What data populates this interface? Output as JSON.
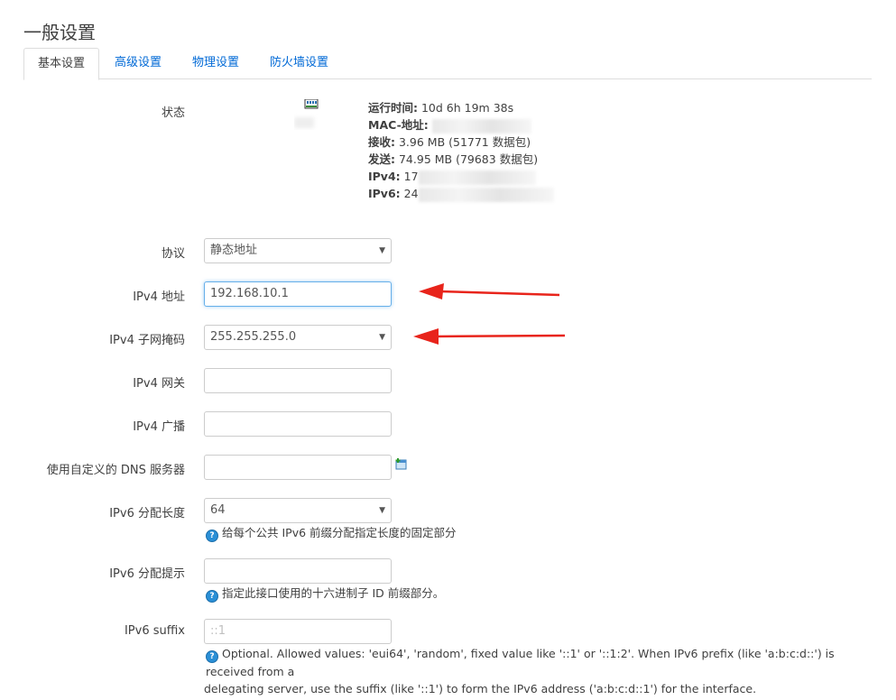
{
  "page": {
    "title": "一般设置"
  },
  "tabs": [
    {
      "label": "基本设置",
      "active": true
    },
    {
      "label": "高级设置",
      "active": false
    },
    {
      "label": "物理设置",
      "active": false
    },
    {
      "label": "防火墙设置",
      "active": false
    }
  ],
  "status": {
    "label": "状态",
    "uptime_key": "运行时间:",
    "uptime_val": "10d 6h 19m 38s",
    "mac_key": "MAC-地址:",
    "mac_val": "",
    "rx_key": "接收:",
    "rx_val": "3.96 MB (51771 数据包)",
    "tx_key": "发送:",
    "tx_val": "74.95 MB (79683 数据包)",
    "ipv4_key": "IPv4:",
    "ipv4_val": "17",
    "ipv6_key": "IPv6:",
    "ipv6_val": "24"
  },
  "form": {
    "protocol": {
      "label": "协议",
      "value": "静态地址"
    },
    "ipv4_addr": {
      "label": "IPv4 地址",
      "value": "192.168.10.1"
    },
    "ipv4_mask": {
      "label": "IPv4 子网掩码",
      "value": "255.255.255.0"
    },
    "ipv4_gateway": {
      "label": "IPv4 网关",
      "value": ""
    },
    "ipv4_broadcast": {
      "label": "IPv4 广播",
      "value": ""
    },
    "dns": {
      "label": "使用自定义的 DNS 服务器",
      "value": ""
    },
    "ipv6_assign_len": {
      "label": "IPv6 分配长度",
      "value": "64",
      "help": "给每个公共 IPv6 前缀分配指定长度的固定部分"
    },
    "ipv6_assign_hint": {
      "label": "IPv6 分配提示",
      "value": "",
      "help": "指定此接口使用的十六进制子 ID 前缀部分。"
    },
    "ipv6_suffix": {
      "label": "IPv6 suffix",
      "placeholder": "::1",
      "help_line1": "Optional. Allowed values: 'eui64', 'random', fixed value like '::1' or '::1:2'. When IPv6 prefix (like 'a:b:c:d::') is received from a",
      "help_line2": "delegating server, use the suffix (like '::1') to form the IPv6 address ('a:b:c:d::1') for the interface."
    }
  },
  "colors": {
    "annotation_arrow": "#e8241b",
    "link": "#0069d6",
    "focus": "#66afe9"
  }
}
